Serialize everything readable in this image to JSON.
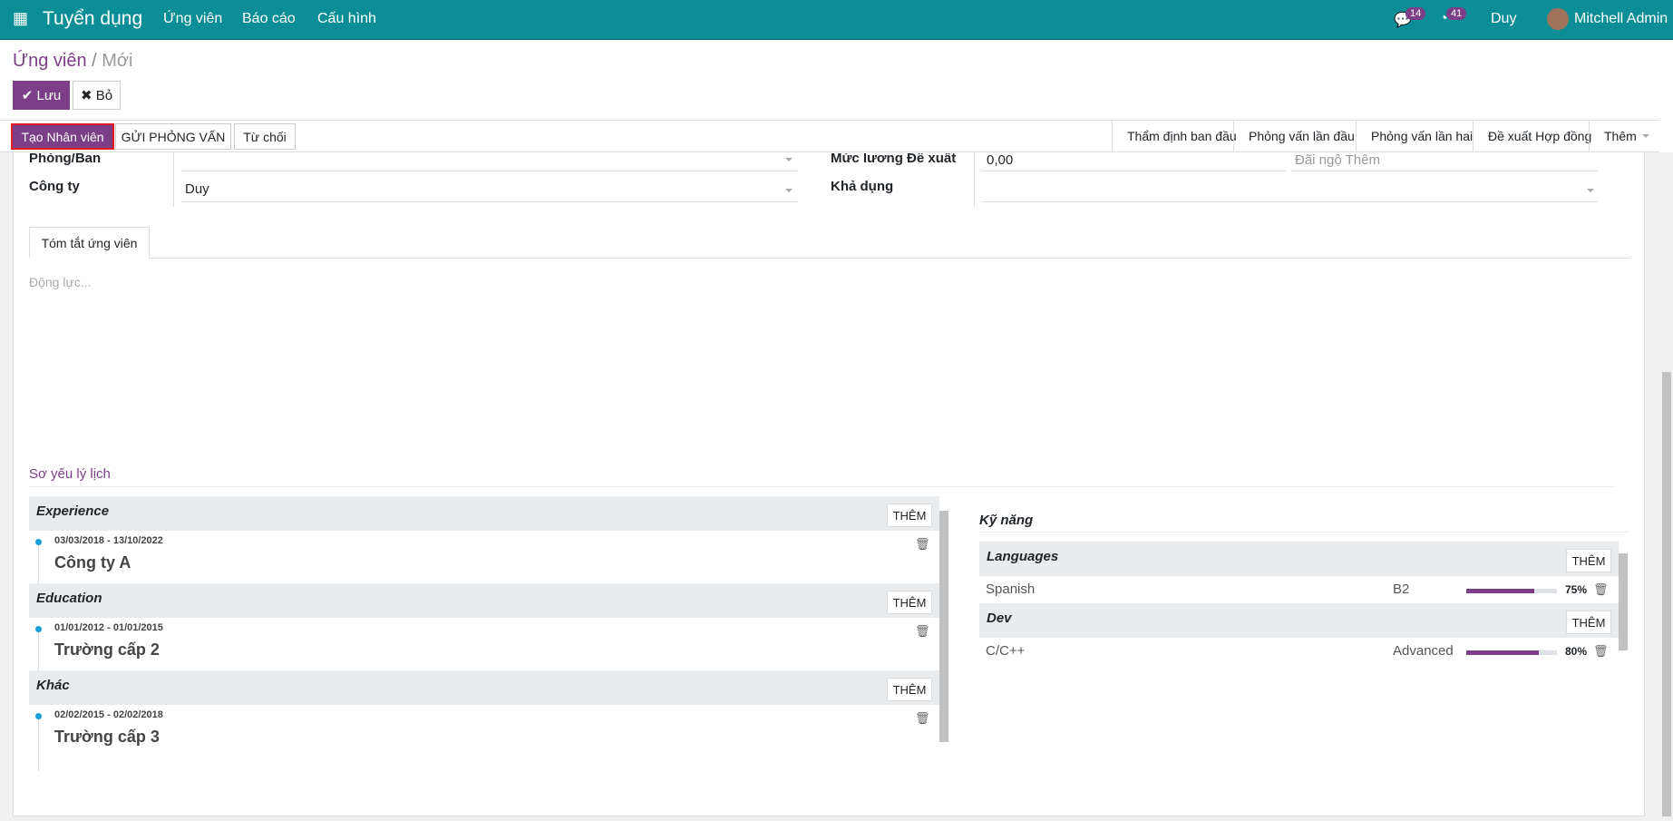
{
  "navbar": {
    "app": "Tuyển dụng",
    "menu": [
      "Ứng viên",
      "Báo cáo",
      "Cấu hình"
    ],
    "messages_count": "14",
    "activities_count": "41",
    "company": "Duy",
    "user": "Mitchell Admin",
    "color": "#0b8e96"
  },
  "breadcrumb": {
    "parent": "Ứng viên",
    "sep": "/",
    "current": "Mới"
  },
  "buttons": {
    "save": "Lưu",
    "discard": "Bỏ",
    "create_employee": "Tạo Nhân viên",
    "send_interview": "GỬI PHỎNG VẤN",
    "refuse": "Từ chối"
  },
  "stages": [
    "Thẩm định ban đầu",
    "Phỏng vấn lần đầu",
    "Phỏng vấn lần hai",
    "Đề xuất Hợp đồng",
    "Thêm"
  ],
  "fields": {
    "department_label": "Phòng/Ban",
    "department_value": "",
    "company_label": "Công ty",
    "company_value": "Duy",
    "salary_label": "Mức lương Đề xuất",
    "salary_value": "0,00",
    "extra_placeholder": "Đãi ngộ Thêm",
    "availability_label": "Khả dụng",
    "availability_value": ""
  },
  "tab": "Tóm tắt ứng viên",
  "motivation_placeholder": "Động lực...",
  "resume": {
    "title": "Sơ yếu lý lịch",
    "add": "THÊM",
    "groups": [
      {
        "name": "Experience",
        "items": [
          {
            "dates": "03/03/2018 - 13/10/2022",
            "name": "Công ty A"
          }
        ]
      },
      {
        "name": "Education",
        "items": [
          {
            "dates": "01/01/2012 - 01/01/2015",
            "name": "Trường cấp 2"
          }
        ]
      },
      {
        "name": "Khác",
        "items": [
          {
            "dates": "02/02/2015 - 02/02/2018",
            "name": "Trường cấp 3"
          }
        ]
      }
    ]
  },
  "skills": {
    "title": "Kỹ năng",
    "add": "THÊM",
    "groups": [
      {
        "name": "Languages",
        "items": [
          {
            "skill": "Spanish",
            "level": "B2",
            "progress": 75,
            "progress_label": "75%"
          }
        ]
      },
      {
        "name": "Dev",
        "items": [
          {
            "skill": "C/C++",
            "level": "Advanced",
            "progress": 80,
            "progress_label": "80%"
          }
        ]
      }
    ]
  },
  "accent": "#7c3f87"
}
